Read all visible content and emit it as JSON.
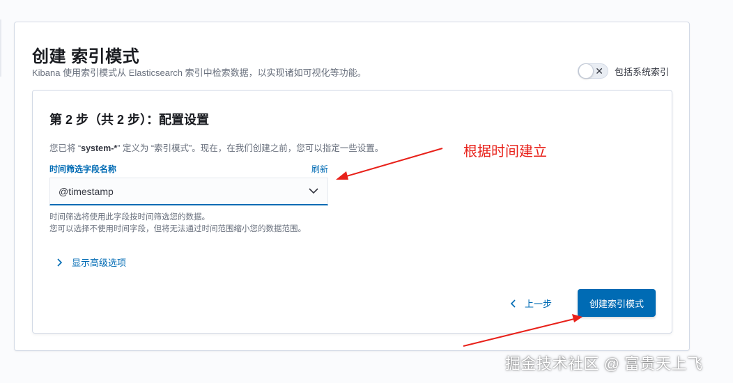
{
  "header": {
    "title": "创建 索引模式",
    "subtitle": "Kibana 使用索引模式从 Elasticsearch 索引中检索数据，以实现诸如可视化等功能。",
    "include_system_label": "包括系统索引",
    "include_system_on": false
  },
  "step": {
    "title": "第 2 步（共 2 步）：配置设置",
    "desc_prefix": "您已将 “",
    "pattern": "system-*",
    "desc_suffix": "” 定义为 “索引模式”。现在，在我们创建之前，您可以指定一些设置。",
    "field_label": "时间筛选字段名称",
    "refresh_label": "刷新",
    "time_field_value": "@timestamp",
    "help_line1": "时间筛选将使用此字段按时间筛选您的数据。",
    "help_line2": "您可以选择不使用时间字段，但将无法通过时间范围缩小您的数据范围。",
    "advanced_label": "显示高级选项"
  },
  "footer": {
    "back_label": "上一步",
    "create_label": "创建索引模式"
  },
  "annotation": {
    "text": "根据时间建立"
  },
  "watermark": "掘金技术社区 @ 富贵天上飞",
  "colors": {
    "accent": "#006bb4",
    "annotation": "#e8211a"
  }
}
